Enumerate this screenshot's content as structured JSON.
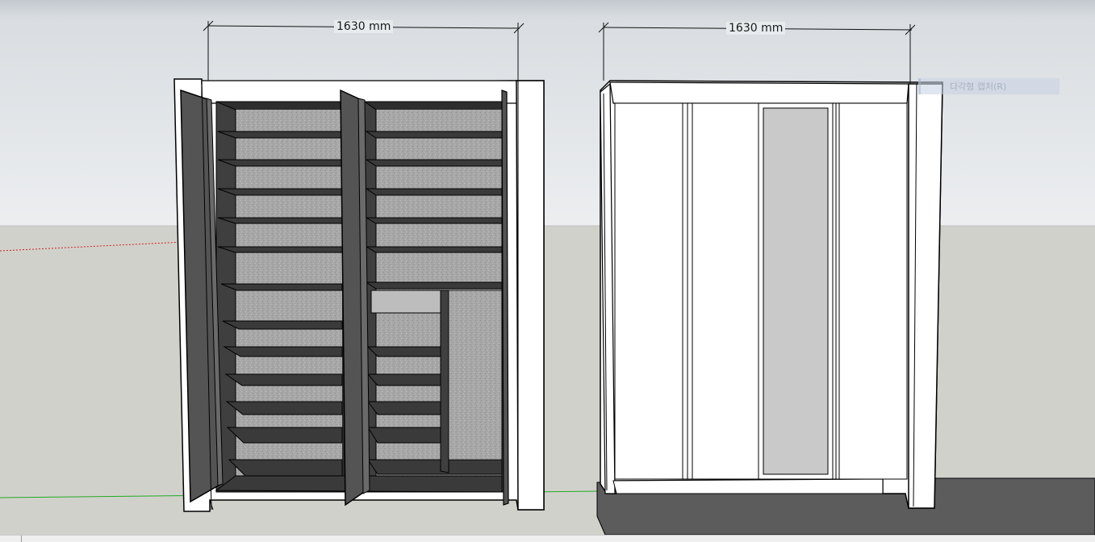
{
  "viewport": {
    "background_sky": "#e2e6ea",
    "background_ground": "#d1d1cc"
  },
  "dimensions": [
    {
      "label": "1630 mm"
    },
    {
      "label": "1630 mm"
    }
  ],
  "context_menu": {
    "item_label": "다각형 캡처(R)"
  },
  "colors": {
    "carcass_white": "#ffffff",
    "shelf_dark": "#3a3a3a",
    "back_panel": "#a9a9a9",
    "door_dark": "#545454",
    "mirror": "#c9c9c9",
    "outline": "#000000",
    "floor_dark": "#5f5f5f",
    "axis_green": "#22aa22",
    "axis_red": "#cc2222"
  }
}
